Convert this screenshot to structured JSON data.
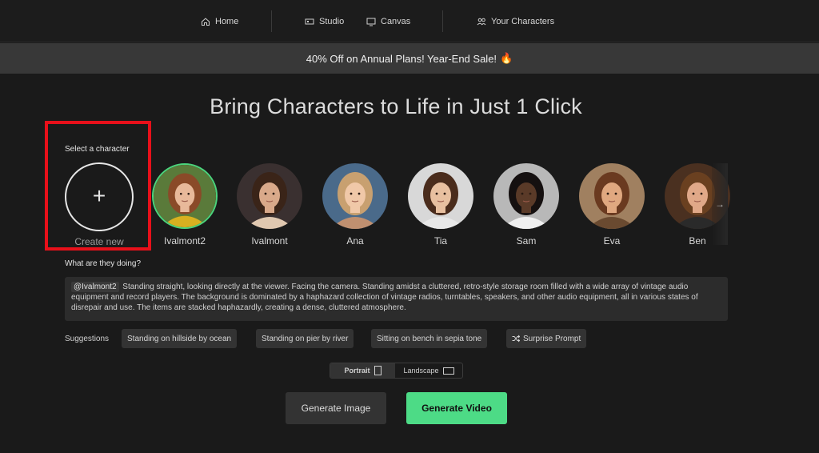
{
  "nav": {
    "home": "Home",
    "studio": "Studio",
    "canvas": "Canvas",
    "characters": "Your Characters"
  },
  "promo": {
    "text": "40% Off on Annual Plans! Year-End Sale!",
    "emoji": "🔥"
  },
  "hero": {
    "title": "Bring Characters to Life in Just 1 Click"
  },
  "selector": {
    "label": "Select a character",
    "create_new": "Create new",
    "characters": [
      {
        "name": "Ivalmont2",
        "selected": true,
        "hair": "#8a4a28",
        "skin": "#e8b99a",
        "bg": "#5a7a3a",
        "shirt": "#d8b020"
      },
      {
        "name": "Ivalmont",
        "selected": false,
        "hair": "#3a2418",
        "skin": "#d9a98a",
        "bg": "#3a3030",
        "shirt": "#e0c8b0"
      },
      {
        "name": "Ana",
        "selected": false,
        "hair": "#c8a070",
        "skin": "#f0c8a8",
        "bg": "#4a6a8a",
        "shirt": "#c09070"
      },
      {
        "name": "Tia",
        "selected": false,
        "hair": "#4a2c1c",
        "skin": "#e8c0a0",
        "bg": "#d8d8d8",
        "shirt": "#e8e8e8"
      },
      {
        "name": "Sam",
        "selected": false,
        "hair": "#151010",
        "skin": "#5a3a28",
        "bg": "#b8b8b8",
        "shirt": "#f0f0f0"
      },
      {
        "name": "Eva",
        "selected": false,
        "hair": "#6a3a20",
        "skin": "#e0a880",
        "bg": "#a08060",
        "shirt": "#6a4a30"
      },
      {
        "name": "Ben",
        "selected": false,
        "hair": "#6a4020",
        "skin": "#e0a888",
        "bg": "#4a3020",
        "shirt": "#2a2a2a"
      }
    ]
  },
  "prompt": {
    "label": "What are they doing?",
    "mention": "@Ivalmont2",
    "text": "Standing straight, looking directly at the viewer. Facing the camera. Standing amidst a cluttered, retro-style storage room filled with a wide array of vintage audio equipment and record players. The background is dominated by a haphazard collection of vintage radios, turntables, speakers, and other audio equipment, all in various states of disrepair and use. The items are stacked haphazardly, creating a dense, cluttered atmosphere."
  },
  "suggestions": {
    "label": "Suggestions",
    "items": [
      "Standing on hillside by ocean",
      "Standing on pier by river",
      "Sitting on bench in sepia tone",
      "Surprise Prompt"
    ]
  },
  "orientation": {
    "portrait": "Portrait",
    "landscape": "Landscape",
    "selected": "Portrait"
  },
  "actions": {
    "generate_image": "Generate Image",
    "generate_video": "Generate Video"
  },
  "colors": {
    "accent": "#4ddb86",
    "highlight": "#e8101a",
    "background": "#1a1a1a"
  }
}
